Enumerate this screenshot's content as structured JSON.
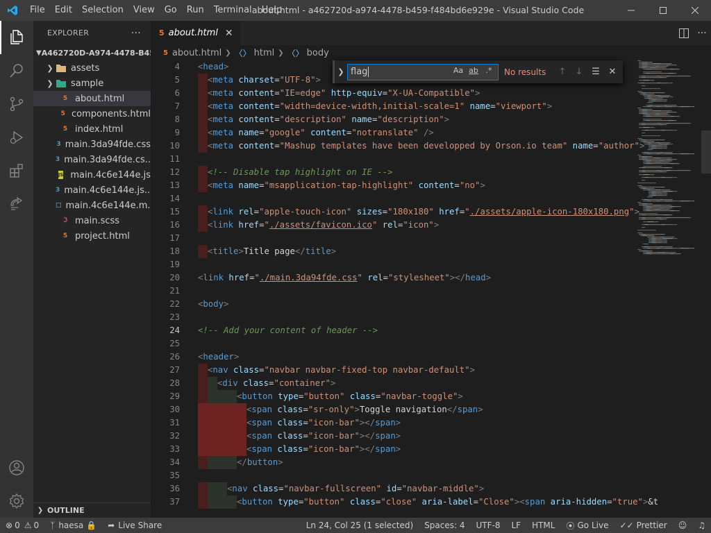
{
  "window": {
    "title": "about.html - a462720d-a974-4478-b459-f484bd6e929e - Visual Studio Code"
  },
  "menu": [
    "File",
    "Edit",
    "Selection",
    "View",
    "Go",
    "Run",
    "Terminal",
    "Help"
  ],
  "sidebar": {
    "header": "EXPLORER",
    "more": "···",
    "folder": "A462720D-A974-4478-B45...",
    "items": [
      {
        "label": "assets",
        "type": "folder"
      },
      {
        "label": "sample",
        "type": "folder"
      },
      {
        "label": "about.html",
        "type": "html"
      },
      {
        "label": "components.html",
        "type": "html"
      },
      {
        "label": "index.html",
        "type": "html"
      },
      {
        "label": "main.3da94fde.css",
        "type": "css"
      },
      {
        "label": "main.3da94fde.cs...",
        "type": "css"
      },
      {
        "label": "main.4c6e144e.js",
        "type": "js"
      },
      {
        "label": "main.4c6e144e.js....",
        "type": "css"
      },
      {
        "label": "main.4c6e144e.m...",
        "type": "file"
      },
      {
        "label": "main.scss",
        "type": "scss"
      },
      {
        "label": "project.html",
        "type": "html"
      }
    ],
    "outline": "OUTLINE"
  },
  "tab": {
    "label": "about.html"
  },
  "breadcrumb": [
    "about.html",
    "html",
    "body"
  ],
  "find": {
    "value": "flag",
    "result": "No results",
    "opt_case": "Aa",
    "opt_word": "ab",
    "opt_regex": ".*"
  },
  "code": [
    {
      "n": "4",
      "ind": 0,
      "h": [
        [
          "t",
          "<"
        ],
        [
          "tg",
          "head"
        ],
        [
          "t",
          ">"
        ]
      ]
    },
    {
      "n": "5",
      "ind": 1,
      "h": [
        [
          "t",
          "<"
        ],
        [
          "tg",
          "meta"
        ],
        [
          "at",
          " charset"
        ],
        [
          "tx",
          "="
        ],
        [
          "s",
          "\"UTF-8\""
        ],
        [
          "t",
          ">"
        ]
      ]
    },
    {
      "n": "6",
      "ind": 1,
      "h": [
        [
          "t",
          "<"
        ],
        [
          "tg",
          "meta"
        ],
        [
          "at",
          " content"
        ],
        [
          "tx",
          "="
        ],
        [
          "s",
          "\"IE=edge\""
        ],
        [
          "at",
          " http-equiv"
        ],
        [
          "tx",
          "="
        ],
        [
          "s",
          "\"X-UA-Compatible\""
        ],
        [
          "t",
          ">"
        ]
      ]
    },
    {
      "n": "7",
      "ind": 1,
      "h": [
        [
          "t",
          "<"
        ],
        [
          "tg",
          "meta"
        ],
        [
          "at",
          " content"
        ],
        [
          "tx",
          "="
        ],
        [
          "s",
          "\"width=device-width,initial-scale=1\""
        ],
        [
          "at",
          " name"
        ],
        [
          "tx",
          "="
        ],
        [
          "s",
          "\"viewport\""
        ],
        [
          "t",
          ">"
        ]
      ]
    },
    {
      "n": "8",
      "ind": 1,
      "h": [
        [
          "t",
          "<"
        ],
        [
          "tg",
          "meta"
        ],
        [
          "at",
          " content"
        ],
        [
          "tx",
          "="
        ],
        [
          "s",
          "\"description\""
        ],
        [
          "at",
          " name"
        ],
        [
          "tx",
          "="
        ],
        [
          "s",
          "\"description\""
        ],
        [
          "t",
          ">"
        ]
      ]
    },
    {
      "n": "9",
      "ind": 1,
      "h": [
        [
          "t",
          "<"
        ],
        [
          "tg",
          "meta"
        ],
        [
          "at",
          " name"
        ],
        [
          "tx",
          "="
        ],
        [
          "s",
          "\"google\""
        ],
        [
          "at",
          " content"
        ],
        [
          "tx",
          "="
        ],
        [
          "s",
          "\"notranslate\""
        ],
        [
          "t",
          " />"
        ]
      ]
    },
    {
      "n": "10",
      "ind": 1,
      "h": [
        [
          "t",
          "<"
        ],
        [
          "tg",
          "meta"
        ],
        [
          "at",
          " content"
        ],
        [
          "tx",
          "="
        ],
        [
          "s",
          "\"Mashup templates have been developped by Orson.io team\""
        ],
        [
          "at",
          " name"
        ],
        [
          "tx",
          "="
        ],
        [
          "s",
          "\"author\""
        ],
        [
          "t",
          ">"
        ]
      ]
    },
    {
      "n": "11",
      "ind": 0,
      "h": []
    },
    {
      "n": "12",
      "ind": 1,
      "h": [
        [
          "c",
          "<!-- Disable tap highlight on IE -->"
        ]
      ]
    },
    {
      "n": "13",
      "ind": 1,
      "h": [
        [
          "t",
          "<"
        ],
        [
          "tg",
          "meta"
        ],
        [
          "at",
          " name"
        ],
        [
          "tx",
          "="
        ],
        [
          "s",
          "\"msapplication-tap-highlight\""
        ],
        [
          "at",
          " content"
        ],
        [
          "tx",
          "="
        ],
        [
          "s",
          "\"no\""
        ],
        [
          "t",
          ">"
        ]
      ]
    },
    {
      "n": "14",
      "ind": 0,
      "h": []
    },
    {
      "n": "15",
      "ind": 1,
      "h": [
        [
          "t",
          "<"
        ],
        [
          "tg",
          "link"
        ],
        [
          "at",
          " rel"
        ],
        [
          "tx",
          "="
        ],
        [
          "s",
          "\"apple-touch-icon\""
        ],
        [
          "at",
          " sizes"
        ],
        [
          "tx",
          "="
        ],
        [
          "s",
          "\"180x180\""
        ],
        [
          "at",
          " href"
        ],
        [
          "tx",
          "="
        ],
        [
          "s",
          "\""
        ],
        [
          "su",
          "./assets/apple-icon-180x180.png"
        ],
        [
          "s",
          "\""
        ],
        [
          "t",
          ">"
        ]
      ]
    },
    {
      "n": "16",
      "ind": 1,
      "h": [
        [
          "t",
          "<"
        ],
        [
          "tg",
          "link"
        ],
        [
          "at",
          " href"
        ],
        [
          "tx",
          "="
        ],
        [
          "s",
          "\""
        ],
        [
          "su",
          "./assets/favicon.ico"
        ],
        [
          "s",
          "\""
        ],
        [
          "at",
          " rel"
        ],
        [
          "tx",
          "="
        ],
        [
          "s",
          "\"icon\""
        ],
        [
          "t",
          ">"
        ]
      ]
    },
    {
      "n": "17",
      "ind": 0,
      "h": []
    },
    {
      "n": "18",
      "ind": 1,
      "h": [
        [
          "t",
          "<"
        ],
        [
          "tg",
          "title"
        ],
        [
          "t",
          ">"
        ],
        [
          "tx",
          "Title page"
        ],
        [
          "t",
          "</"
        ],
        [
          "tg",
          "title"
        ],
        [
          "t",
          ">"
        ]
      ]
    },
    {
      "n": "19",
      "ind": 0,
      "h": []
    },
    {
      "n": "20",
      "ind": 0,
      "h": [
        [
          "t",
          "<"
        ],
        [
          "tg",
          "link"
        ],
        [
          "at",
          " href"
        ],
        [
          "tx",
          "="
        ],
        [
          "s",
          "\""
        ],
        [
          "su",
          "./main.3da94fde.css"
        ],
        [
          "s",
          "\""
        ],
        [
          "at",
          " rel"
        ],
        [
          "tx",
          "="
        ],
        [
          "s",
          "\"stylesheet\""
        ],
        [
          "t",
          "></"
        ],
        [
          "tg",
          "head"
        ],
        [
          "t",
          ">"
        ]
      ]
    },
    {
      "n": "21",
      "ind": 0,
      "h": []
    },
    {
      "n": "22",
      "ind": 0,
      "h": [
        [
          "t",
          "<"
        ],
        [
          "tg",
          "body"
        ],
        [
          "t",
          ">"
        ]
      ]
    },
    {
      "n": "23",
      "ind": 0,
      "h": []
    },
    {
      "n": "24",
      "ind": 0,
      "h": [
        [
          "c",
          "<!-- Add your content of header -->"
        ]
      ]
    },
    {
      "n": "25",
      "ind": 0,
      "h": []
    },
    {
      "n": "26",
      "ind": 0,
      "h": [
        [
          "t",
          "<"
        ],
        [
          "tg",
          "header"
        ],
        [
          "t",
          ">"
        ]
      ]
    },
    {
      "n": "27",
      "ind": 1,
      "h": [
        [
          "t",
          "<"
        ],
        [
          "tg",
          "nav"
        ],
        [
          "at",
          " class"
        ],
        [
          "tx",
          "="
        ],
        [
          "s",
          "\"navbar navbar-fixed-top navbar-default\""
        ],
        [
          "t",
          ">"
        ]
      ]
    },
    {
      "n": "28",
      "ind": 2,
      "h": [
        [
          "t",
          "<"
        ],
        [
          "tg",
          "div"
        ],
        [
          "at",
          " class"
        ],
        [
          "tx",
          "="
        ],
        [
          "s",
          "\"container\""
        ],
        [
          "t",
          ">"
        ]
      ]
    },
    {
      "n": "29",
      "ind": 4,
      "h": [
        [
          "t",
          "<"
        ],
        [
          "tg",
          "button"
        ],
        [
          "at",
          " type"
        ],
        [
          "tx",
          "="
        ],
        [
          "s",
          "\"button\""
        ],
        [
          "at",
          " class"
        ],
        [
          "tx",
          "="
        ],
        [
          "s",
          "\"navbar-toggle\""
        ],
        [
          "t",
          ">"
        ]
      ]
    },
    {
      "n": "30",
      "ind": 5,
      "h": [
        [
          "t",
          "<"
        ],
        [
          "tg",
          "span"
        ],
        [
          "at",
          " class"
        ],
        [
          "tx",
          "="
        ],
        [
          "s",
          "\"sr-only\""
        ],
        [
          "t",
          ">"
        ],
        [
          "tx",
          "Toggle navigation"
        ],
        [
          "t",
          "</"
        ],
        [
          "tg",
          "span"
        ],
        [
          "t",
          ">"
        ]
      ]
    },
    {
      "n": "31",
      "ind": 5,
      "h": [
        [
          "t",
          "<"
        ],
        [
          "tg",
          "span"
        ],
        [
          "at",
          " class"
        ],
        [
          "tx",
          "="
        ],
        [
          "s",
          "\"icon-bar\""
        ],
        [
          "t",
          "></"
        ],
        [
          "tg",
          "span"
        ],
        [
          "t",
          ">"
        ]
      ]
    },
    {
      "n": "32",
      "ind": 5,
      "h": [
        [
          "t",
          "<"
        ],
        [
          "tg",
          "span"
        ],
        [
          "at",
          " class"
        ],
        [
          "tx",
          "="
        ],
        [
          "s",
          "\"icon-bar\""
        ],
        [
          "t",
          "></"
        ],
        [
          "tg",
          "span"
        ],
        [
          "t",
          ">"
        ]
      ]
    },
    {
      "n": "33",
      "ind": 5,
      "h": [
        [
          "t",
          "<"
        ],
        [
          "tg",
          "span"
        ],
        [
          "at",
          " class"
        ],
        [
          "tx",
          "="
        ],
        [
          "s",
          "\"icon-bar\""
        ],
        [
          "t",
          "></"
        ],
        [
          "tg",
          "span"
        ],
        [
          "t",
          ">"
        ]
      ]
    },
    {
      "n": "34",
      "ind": 4,
      "h": [
        [
          "t",
          "</"
        ],
        [
          "tg",
          "button"
        ],
        [
          "t",
          ">"
        ]
      ]
    },
    {
      "n": "35",
      "ind": 0,
      "h": []
    },
    {
      "n": "36",
      "ind": 3,
      "h": [
        [
          "t",
          "<"
        ],
        [
          "tg",
          "nav"
        ],
        [
          "at",
          " class"
        ],
        [
          "tx",
          "="
        ],
        [
          "s",
          "\"navbar-fullscreen\""
        ],
        [
          "at",
          " id"
        ],
        [
          "tx",
          "="
        ],
        [
          "s",
          "\"navbar-middle\""
        ],
        [
          "t",
          ">"
        ]
      ]
    },
    {
      "n": "37",
      "ind": 4,
      "h": [
        [
          "t",
          "<"
        ],
        [
          "tg",
          "button"
        ],
        [
          "at",
          " type"
        ],
        [
          "tx",
          "="
        ],
        [
          "s",
          "\"button\""
        ],
        [
          "at",
          " class"
        ],
        [
          "tx",
          "="
        ],
        [
          "s",
          "\"close\""
        ],
        [
          "at",
          " aria-label"
        ],
        [
          "tx",
          "="
        ],
        [
          "s",
          "\"Close\""
        ],
        [
          "t",
          ">"
        ],
        [
          "t",
          "<"
        ],
        [
          "tg",
          "span"
        ],
        [
          "at",
          " aria-hidden"
        ],
        [
          "tx",
          "="
        ],
        [
          "s",
          "\"true\""
        ],
        [
          "t",
          ">"
        ],
        [
          "tx",
          "&t"
        ]
      ]
    }
  ],
  "status": {
    "errors": "0",
    "warnings": "0",
    "user": "haesa",
    "live_share": "Live Share",
    "position": "Ln 24, Col 25 (1 selected)",
    "spaces": "Spaces: 4",
    "encoding": "UTF-8",
    "eol": "LF",
    "language": "HTML",
    "go_live": "Go Live",
    "prettier": "Prettier"
  },
  "colors": {
    "accent": "#007acc",
    "find_no_results": "#f48771",
    "html_icon": "#e37933",
    "css_icon": "#519aba",
    "js_icon": "#cbcb41",
    "scss_icon": "#f55385"
  }
}
